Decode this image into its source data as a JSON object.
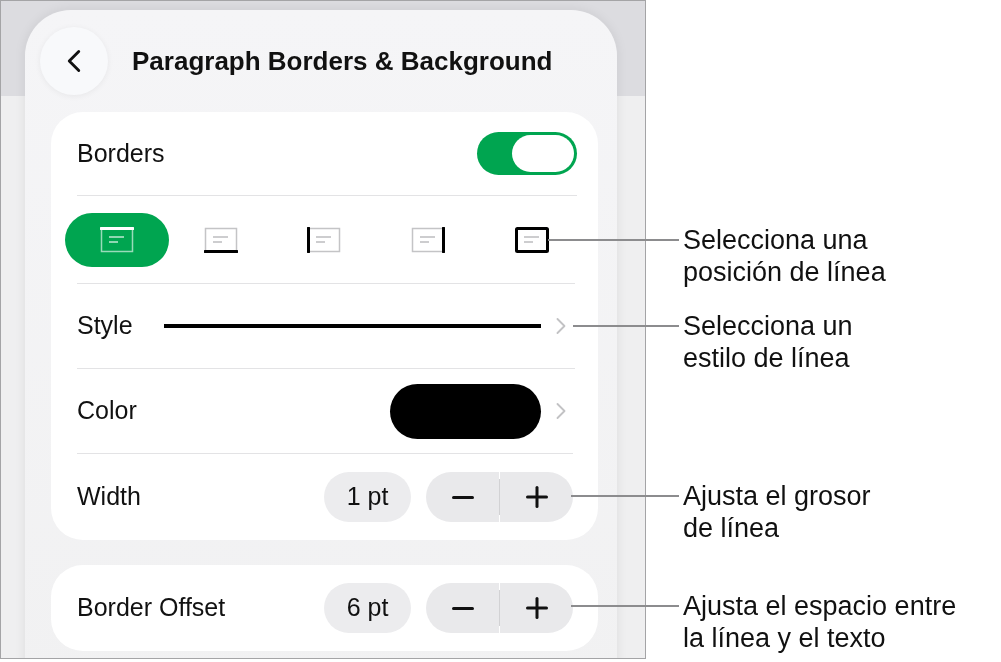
{
  "header": {
    "title": "Paragraph Borders & Background"
  },
  "borders": {
    "label": "Borders",
    "on": true
  },
  "positions": [
    {
      "kind": "top",
      "selected": true
    },
    {
      "kind": "bottom",
      "selected": false
    },
    {
      "kind": "left",
      "selected": false
    },
    {
      "kind": "right",
      "selected": false
    },
    {
      "kind": "box",
      "selected": false
    }
  ],
  "style": {
    "label": "Style"
  },
  "color": {
    "label": "Color",
    "color": "#000000"
  },
  "width": {
    "label": "Width",
    "value": "1 pt"
  },
  "border_offset": {
    "label": "Border Offset",
    "value": "6 pt"
  },
  "callouts": [
    {
      "text": "Selecciona una\nposición de línea"
    },
    {
      "text": "Selecciona un\nestilo de línea"
    },
    {
      "text": "Ajusta el grosor\nde línea"
    },
    {
      "text": "Ajusta el espacio entre\nla línea y el texto"
    }
  ]
}
